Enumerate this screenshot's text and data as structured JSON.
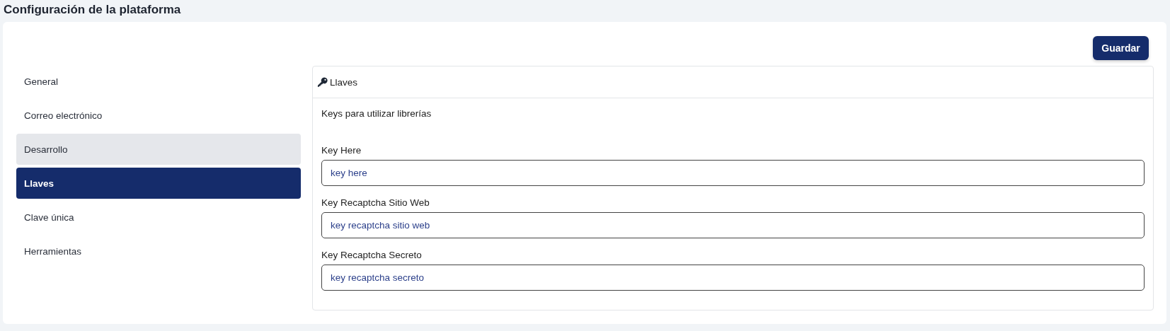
{
  "page_title": "Configuración de la plataforma",
  "save_button": "Guardar",
  "sidebar": {
    "items": [
      {
        "label": "General",
        "selected": false,
        "hovered": false
      },
      {
        "label": "Correo electrónico",
        "selected": false,
        "hovered": false
      },
      {
        "label": "Desarrollo",
        "selected": false,
        "hovered": true
      },
      {
        "label": "Llaves",
        "selected": true,
        "hovered": false
      },
      {
        "label": "Clave única",
        "selected": false,
        "hovered": false
      },
      {
        "label": "Herramientas",
        "selected": false,
        "hovered": false
      }
    ]
  },
  "panel": {
    "title": "Llaves",
    "description": "Keys para utilizar librerías",
    "fields": [
      {
        "label": "Key Here",
        "value": "key here"
      },
      {
        "label": "Key Recaptcha Sitio Web",
        "value": "key recaptcha sitio web"
      },
      {
        "label": "Key Recaptcha Secreto",
        "value": "key recaptcha secreto"
      }
    ]
  }
}
